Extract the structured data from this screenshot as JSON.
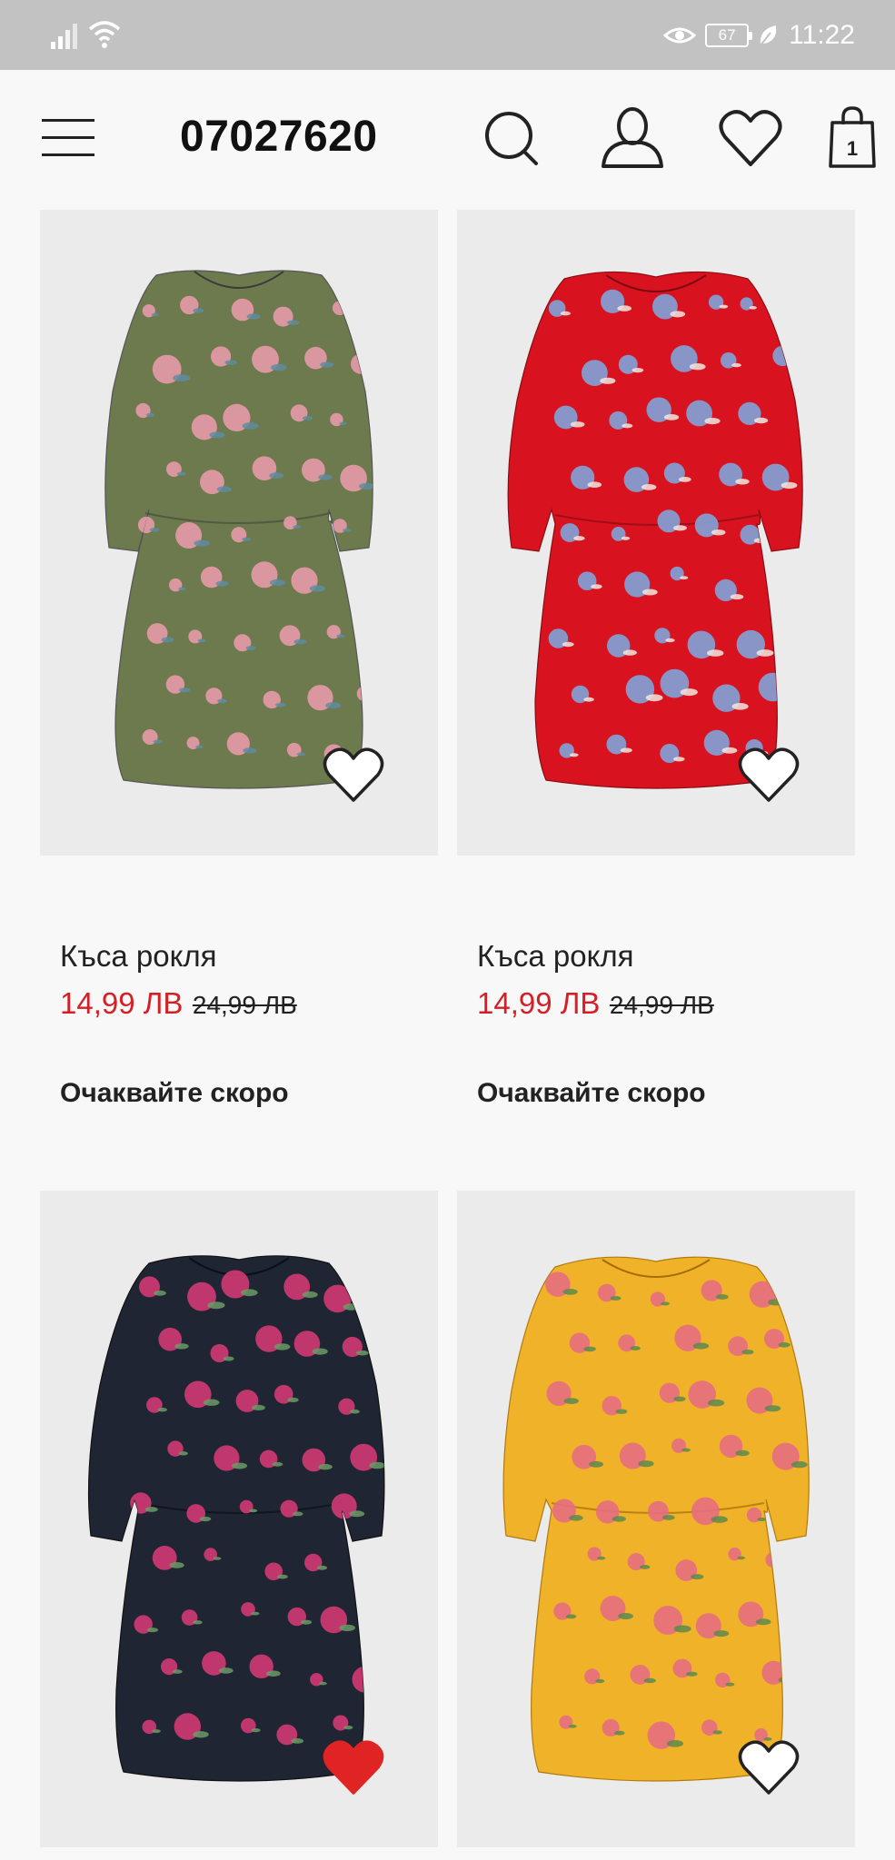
{
  "status_bar": {
    "battery": "67",
    "time": "11:22"
  },
  "header": {
    "title": "07027620",
    "bag_count": "1"
  },
  "products": [
    {
      "name": "Къса рокля",
      "sale_price": "14,99 ЛВ",
      "old_price": "24,99 ЛВ",
      "availability": "Очаквайте скоро",
      "favorited": false,
      "dress_color": "#6c7a4e",
      "flower_color": "#e79aa8",
      "accent_color": "#5f8ca0"
    },
    {
      "name": "Къса рокля",
      "sale_price": "14,99 ЛВ",
      "old_price": "24,99 ЛВ",
      "availability": "Очаквайте скоро",
      "favorited": false,
      "dress_color": "#d8131f",
      "flower_color": "#7fa4d8",
      "accent_color": "#f2e7e0"
    },
    {
      "favorited": true,
      "dress_color": "#1f2533",
      "flower_color": "#d23a73",
      "accent_color": "#6b9a66"
    },
    {
      "favorited": false,
      "dress_color": "#f0b228",
      "flower_color": "#e66d7f",
      "accent_color": "#5c8a4e"
    }
  ],
  "colors": {
    "sale_red": "#d51f26",
    "favorite_red": "#e02424",
    "status_bar_gray": "#c2c2c2"
  }
}
